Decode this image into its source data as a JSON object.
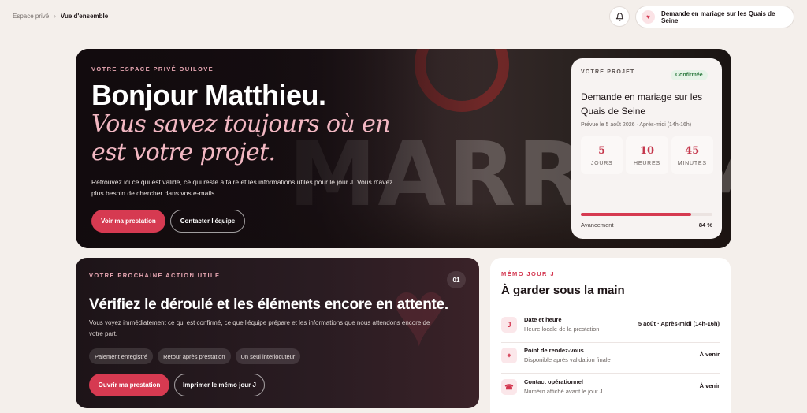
{
  "breadcrumb": {
    "parent": "Espace privé",
    "separator": "›",
    "current": "Vue d'ensemble"
  },
  "header": {
    "project_pill_label": "Demande en mariage sur les Quais de Seine"
  },
  "hero": {
    "eyebrow": "VOTRE ESPACE PRIVÉ OUILOVE",
    "title": "Bonjour Matthieu.",
    "subtitle": "Vous savez toujours où en est votre projet.",
    "text": "Retrouvez ici ce qui est validé, ce qui reste à faire et les informations utiles pour le jour J. Vous n'avez plus besoin de chercher dans vos e-mails.",
    "background_sign": "MARRY ME",
    "primary_button": "Voir ma prestation",
    "secondary_button": "Contacter l'équipe"
  },
  "project_card": {
    "eyebrow": "VOTRE PROJET",
    "status": "Confirmée",
    "title": "Demande en mariage sur les Quais de Seine",
    "date": "Prévue le 5 août 2026 · Après-midi (14h-16h)",
    "countdown": [
      {
        "value": "5",
        "label": "JOURS"
      },
      {
        "value": "10",
        "label": "HEURES"
      },
      {
        "value": "45",
        "label": "MINUTES"
      }
    ],
    "progress_label": "Avancement",
    "progress_value": "84 %",
    "progress_fraction": 0.84
  },
  "next_action": {
    "eyebrow": "VOTRE PROCHAINE ACTION UTILE",
    "number": "01",
    "title": "Vérifiez le déroulé et les éléments encore en attente.",
    "text": "Vous voyez immédiatement ce qui est confirmé, ce que l'équipe prépare et les informations que nous attendons encore de votre part.",
    "chips": [
      "Paiement enregistré",
      "Retour après prestation",
      "Un seul interlocuteur"
    ],
    "primary_button": "Ouvrir ma prestation",
    "secondary_button": "Imprimer le mémo jour J"
  },
  "memo": {
    "eyebrow": "MÉMO JOUR J",
    "title": "À garder sous la main",
    "rows": [
      {
        "icon": "J",
        "label": "Date et heure",
        "sub": "Heure locale de la prestation",
        "value": "5 août · Après-midi (14h-16h)"
      },
      {
        "icon": "⌖",
        "label": "Point de rendez-vous",
        "sub": "Disponible après validation finale",
        "value": "À venir"
      },
      {
        "icon": "☎",
        "label": "Contact opérationnel",
        "sub": "Numéro affiché avant le jour J",
        "value": "À venir"
      }
    ]
  },
  "colors": {
    "accent": "#d63a51",
    "accent_soft": "#f2b7c2",
    "background": "#f4efeb",
    "success": "#2d7a40"
  },
  "icons": {
    "notifications": "bell-icon",
    "project": "heart-icon"
  }
}
